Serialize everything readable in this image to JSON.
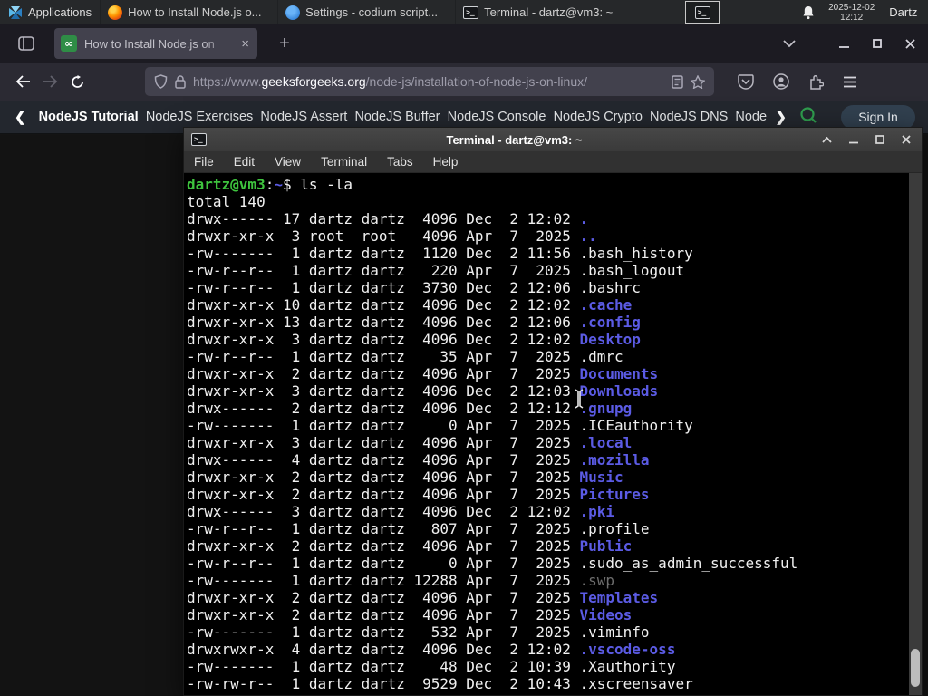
{
  "colors": {
    "term_green": "#3ec43e",
    "term_blue": "#5b5be4",
    "term_dim": "#6e6e6e",
    "gfg_green": "#2f8d46",
    "accent_tab": "#42414d"
  },
  "panel": {
    "applications_label": "Applications",
    "windows": [
      {
        "title": "How to Install Node.js o...",
        "icon": "firefox"
      },
      {
        "title": "Settings - codium script...",
        "icon": "vscodium"
      },
      {
        "title": "Terminal - dartz@vm3: ~",
        "icon": "terminal"
      }
    ],
    "clock_date": "2025-12-02",
    "clock_time": "12:12",
    "user_label": "Dartz"
  },
  "browser": {
    "tab_title": "How to Install Node.js on",
    "favicon_glyph": "∞",
    "new_tab_label": "+",
    "url_scheme": "https://www.",
    "url_domain": "geeksforgeeks.org",
    "url_path": "/node-js/installation-of-node-js-on-linux/"
  },
  "page_nav": {
    "items": [
      "NodeJS Tutorial",
      "NodeJS Exercises",
      "NodeJS Assert",
      "NodeJS Buffer",
      "NodeJS Console",
      "NodeJS Crypto",
      "NodeJS DNS",
      "Node"
    ],
    "sign_in": "Sign In"
  },
  "terminal": {
    "title": "Terminal - dartz@vm3: ~",
    "menu": [
      "File",
      "Edit",
      "View",
      "Terminal",
      "Tabs",
      "Help"
    ],
    "prompt": {
      "user": "dartz@vm3",
      "colon": ":",
      "cwd": "~",
      "symbol": "$ ",
      "command": "ls -la"
    },
    "total_line": "total 140",
    "listing": [
      {
        "perms": "drwx------",
        "n": 17,
        "owner": "dartz",
        "group": "dartz",
        "size": 4096,
        "month": "Dec",
        "day": "2",
        "t": "12:02",
        "name": ".",
        "kind": "dir"
      },
      {
        "perms": "drwxr-xr-x",
        "n": 3,
        "owner": "root",
        "group": "root",
        "size": 4096,
        "month": "Apr",
        "day": "7",
        "t": "2025",
        "name": "..",
        "kind": "dir"
      },
      {
        "perms": "-rw-------",
        "n": 1,
        "owner": "dartz",
        "group": "dartz",
        "size": 1120,
        "month": "Dec",
        "day": "2",
        "t": "11:56",
        "name": ".bash_history",
        "kind": "file"
      },
      {
        "perms": "-rw-r--r--",
        "n": 1,
        "owner": "dartz",
        "group": "dartz",
        "size": 220,
        "month": "Apr",
        "day": "7",
        "t": "2025",
        "name": ".bash_logout",
        "kind": "file"
      },
      {
        "perms": "-rw-r--r--",
        "n": 1,
        "owner": "dartz",
        "group": "dartz",
        "size": 3730,
        "month": "Dec",
        "day": "2",
        "t": "12:06",
        "name": ".bashrc",
        "kind": "file"
      },
      {
        "perms": "drwxr-xr-x",
        "n": 10,
        "owner": "dartz",
        "group": "dartz",
        "size": 4096,
        "month": "Dec",
        "day": "2",
        "t": "12:02",
        "name": ".cache",
        "kind": "dir"
      },
      {
        "perms": "drwxr-xr-x",
        "n": 13,
        "owner": "dartz",
        "group": "dartz",
        "size": 4096,
        "month": "Dec",
        "day": "2",
        "t": "12:06",
        "name": ".config",
        "kind": "dir"
      },
      {
        "perms": "drwxr-xr-x",
        "n": 3,
        "owner": "dartz",
        "group": "dartz",
        "size": 4096,
        "month": "Dec",
        "day": "2",
        "t": "12:02",
        "name": "Desktop",
        "kind": "dir"
      },
      {
        "perms": "-rw-r--r--",
        "n": 1,
        "owner": "dartz",
        "group": "dartz",
        "size": 35,
        "month": "Apr",
        "day": "7",
        "t": "2025",
        "name": ".dmrc",
        "kind": "file"
      },
      {
        "perms": "drwxr-xr-x",
        "n": 2,
        "owner": "dartz",
        "group": "dartz",
        "size": 4096,
        "month": "Apr",
        "day": "7",
        "t": "2025",
        "name": "Documents",
        "kind": "dir"
      },
      {
        "perms": "drwxr-xr-x",
        "n": 3,
        "owner": "dartz",
        "group": "dartz",
        "size": 4096,
        "month": "Dec",
        "day": "2",
        "t": "12:03",
        "name": "Downloads",
        "kind": "dir"
      },
      {
        "perms": "drwx------",
        "n": 2,
        "owner": "dartz",
        "group": "dartz",
        "size": 4096,
        "month": "Dec",
        "day": "2",
        "t": "12:12",
        "name": ".gnupg",
        "kind": "dir"
      },
      {
        "perms": "-rw-------",
        "n": 1,
        "owner": "dartz",
        "group": "dartz",
        "size": 0,
        "month": "Apr",
        "day": "7",
        "t": "2025",
        "name": ".ICEauthority",
        "kind": "file"
      },
      {
        "perms": "drwxr-xr-x",
        "n": 3,
        "owner": "dartz",
        "group": "dartz",
        "size": 4096,
        "month": "Apr",
        "day": "7",
        "t": "2025",
        "name": ".local",
        "kind": "dir"
      },
      {
        "perms": "drwx------",
        "n": 4,
        "owner": "dartz",
        "group": "dartz",
        "size": 4096,
        "month": "Apr",
        "day": "7",
        "t": "2025",
        "name": ".mozilla",
        "kind": "dir"
      },
      {
        "perms": "drwxr-xr-x",
        "n": 2,
        "owner": "dartz",
        "group": "dartz",
        "size": 4096,
        "month": "Apr",
        "day": "7",
        "t": "2025",
        "name": "Music",
        "kind": "dir"
      },
      {
        "perms": "drwxr-xr-x",
        "n": 2,
        "owner": "dartz",
        "group": "dartz",
        "size": 4096,
        "month": "Apr",
        "day": "7",
        "t": "2025",
        "name": "Pictures",
        "kind": "dir"
      },
      {
        "perms": "drwx------",
        "n": 3,
        "owner": "dartz",
        "group": "dartz",
        "size": 4096,
        "month": "Dec",
        "day": "2",
        "t": "12:02",
        "name": ".pki",
        "kind": "dir"
      },
      {
        "perms": "-rw-r--r--",
        "n": 1,
        "owner": "dartz",
        "group": "dartz",
        "size": 807,
        "month": "Apr",
        "day": "7",
        "t": "2025",
        "name": ".profile",
        "kind": "file"
      },
      {
        "perms": "drwxr-xr-x",
        "n": 2,
        "owner": "dartz",
        "group": "dartz",
        "size": 4096,
        "month": "Apr",
        "day": "7",
        "t": "2025",
        "name": "Public",
        "kind": "dir"
      },
      {
        "perms": "-rw-r--r--",
        "n": 1,
        "owner": "dartz",
        "group": "dartz",
        "size": 0,
        "month": "Apr",
        "day": "7",
        "t": "2025",
        "name": ".sudo_as_admin_successful",
        "kind": "file"
      },
      {
        "perms": "-rw-------",
        "n": 1,
        "owner": "dartz",
        "group": "dartz",
        "size": 12288,
        "month": "Apr",
        "day": "7",
        "t": "2025",
        "name": ".swp",
        "kind": "dim"
      },
      {
        "perms": "drwxr-xr-x",
        "n": 2,
        "owner": "dartz",
        "group": "dartz",
        "size": 4096,
        "month": "Apr",
        "day": "7",
        "t": "2025",
        "name": "Templates",
        "kind": "dir"
      },
      {
        "perms": "drwxr-xr-x",
        "n": 2,
        "owner": "dartz",
        "group": "dartz",
        "size": 4096,
        "month": "Apr",
        "day": "7",
        "t": "2025",
        "name": "Videos",
        "kind": "dir"
      },
      {
        "perms": "-rw-------",
        "n": 1,
        "owner": "dartz",
        "group": "dartz",
        "size": 532,
        "month": "Apr",
        "day": "7",
        "t": "2025",
        "name": ".viminfo",
        "kind": "file"
      },
      {
        "perms": "drwxrwxr-x",
        "n": 4,
        "owner": "dartz",
        "group": "dartz",
        "size": 4096,
        "month": "Dec",
        "day": "2",
        "t": "12:02",
        "name": ".vscode-oss",
        "kind": "dir"
      },
      {
        "perms": "-rw-------",
        "n": 1,
        "owner": "dartz",
        "group": "dartz",
        "size": 48,
        "month": "Dec",
        "day": "2",
        "t": "10:39",
        "name": ".Xauthority",
        "kind": "file"
      },
      {
        "perms": "-rw-rw-r--",
        "n": 1,
        "owner": "dartz",
        "group": "dartz",
        "size": 9529,
        "month": "Dec",
        "day": "2",
        "t": "10:43",
        "name": ".xscreensaver",
        "kind": "file"
      }
    ],
    "window_buttons": [
      "shade",
      "minimize",
      "maximize",
      "close"
    ]
  }
}
